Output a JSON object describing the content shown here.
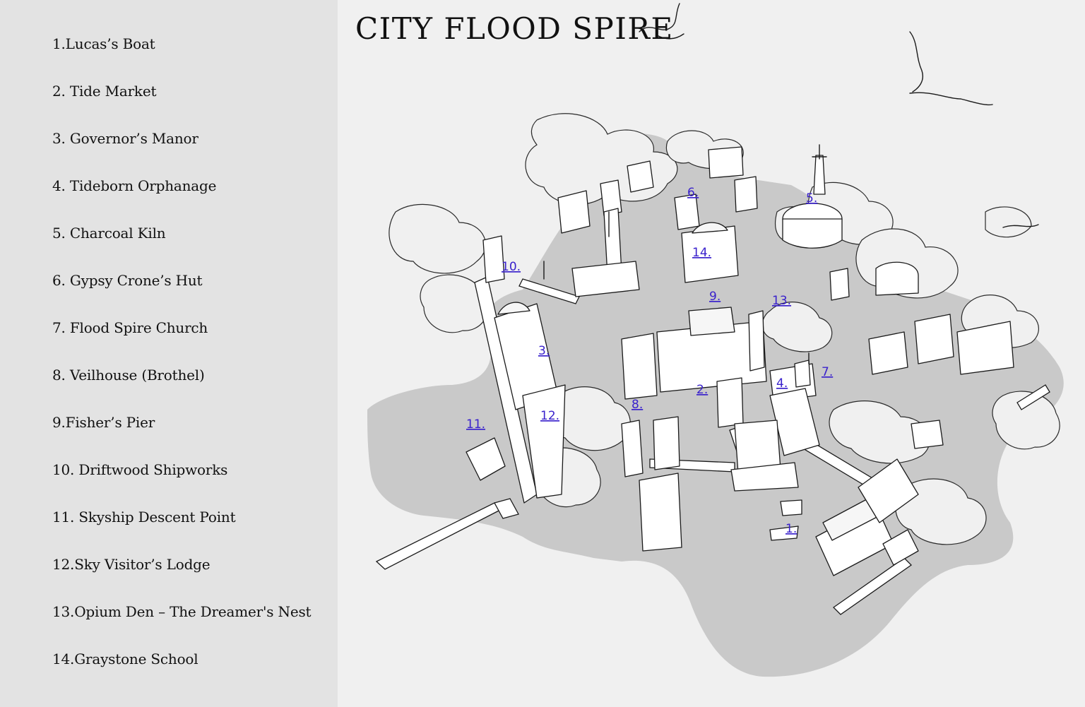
{
  "map": {
    "title": "CITY FLOOD SPIRE",
    "colors": {
      "water": "#c9c9c9",
      "background": "#f0f0f0",
      "legend_panel": "#e3e3e3",
      "marker": "#3a22cc",
      "ink": "#1a1a1a"
    }
  },
  "legend": {
    "items": [
      "1.Lucas’s Boat",
      "2. Tide Market",
      "3. Governor’s Manor",
      "4. Tideborn Orphanage",
      "5. Charcoal Kiln",
      "6. Gypsy Crone’s Hut",
      "7. Flood Spire Church",
      "8. Veilhouse (Brothel)",
      "9.Fisher’s Pier",
      "10. Driftwood Shipworks",
      "11. Skyship Descent Point",
      "12.Sky Visitor’s Lodge",
      "13.Opium Den – The Dreamer's Nest",
      "14.Graystone School"
    ]
  },
  "markers": [
    "1.",
    "2.",
    "3.",
    "4.",
    "5.",
    "6.",
    "7.",
    "8.",
    "9.",
    "10.",
    "11.",
    "12.",
    "13.",
    "14."
  ]
}
